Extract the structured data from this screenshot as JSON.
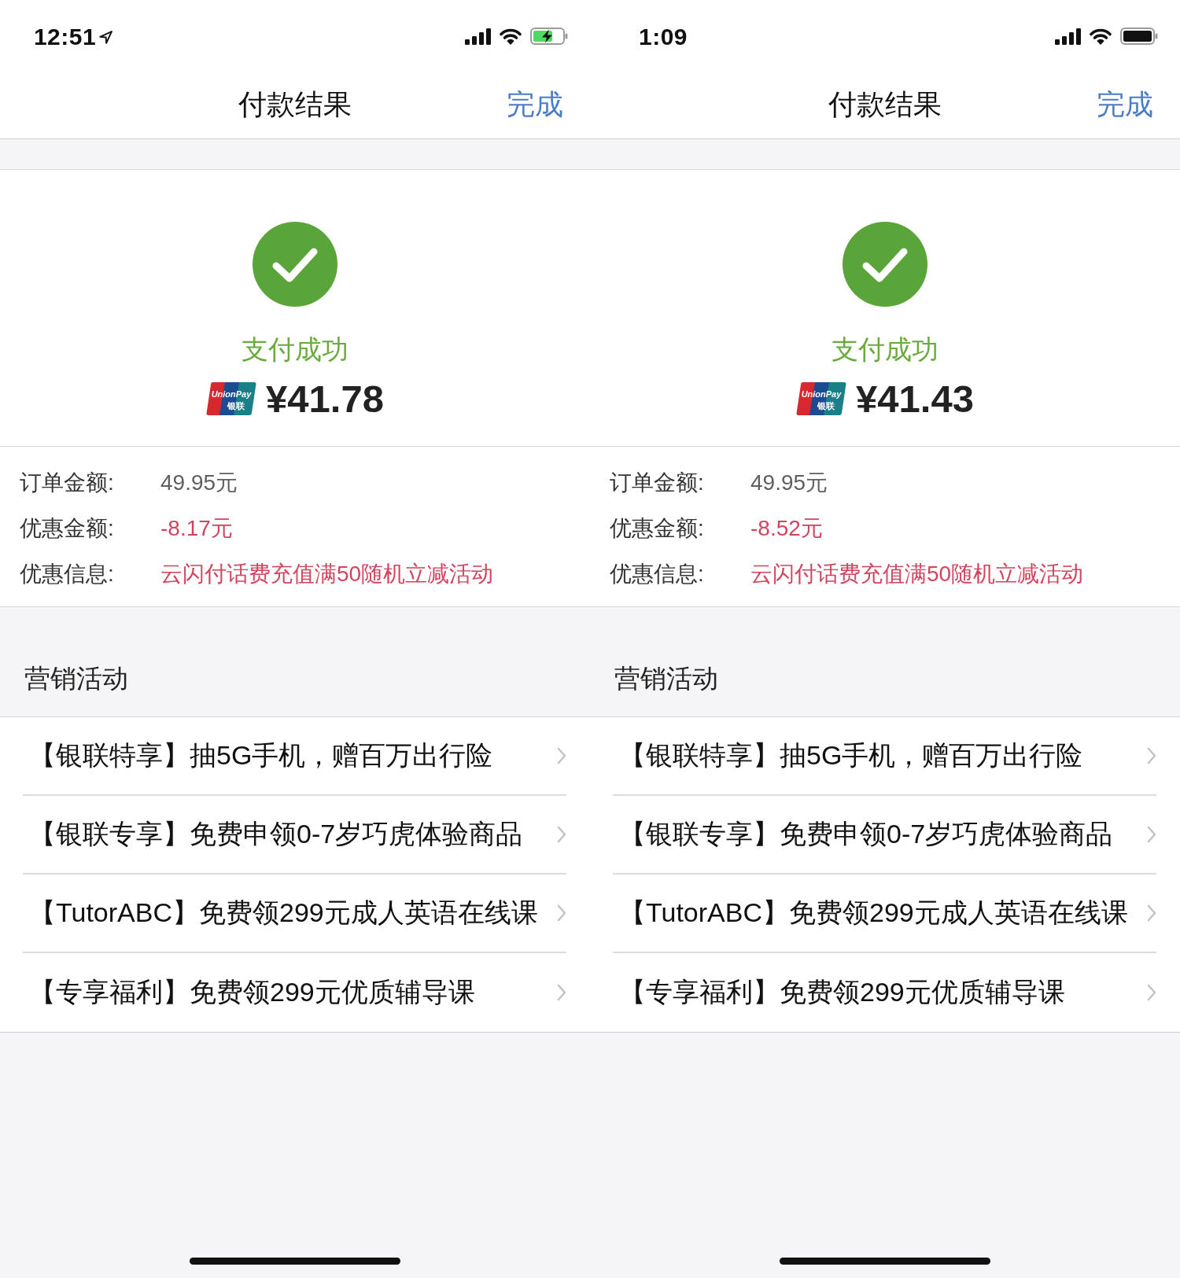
{
  "screens": [
    {
      "status_bar": {
        "time": "12:51",
        "location_services": true,
        "charging": true
      },
      "nav_bar": {
        "title": "付款结果",
        "done_button": "完成"
      },
      "result": {
        "status": "支付成功",
        "card_logo": {
          "latin": "UnionPay",
          "chinese": "银联"
        },
        "amount": "¥41.78"
      },
      "details": [
        {
          "label": "订单金额:",
          "value": "49.95元",
          "kind": "amount"
        },
        {
          "label": "优惠金额:",
          "value": "-8.17元",
          "kind": "discount"
        },
        {
          "label": "优惠信息:",
          "value": "云闪付话费充值满50随机立减活动",
          "kind": "discount"
        }
      ],
      "promotions": {
        "title": "营销活动",
        "items": [
          "【银联特享】抽5G手机，赠百万出行险",
          "【银联专享】免费申领0-7岁巧虎体验商品",
          "【TutorABC】免费领299元成人英语在线课",
          "【专享福利】免费领299元优质辅导课"
        ]
      }
    },
    {
      "status_bar": {
        "time": "1:09",
        "location_services": false,
        "charging": false
      },
      "nav_bar": {
        "title": "付款结果",
        "done_button": "完成"
      },
      "result": {
        "status": "支付成功",
        "card_logo": {
          "latin": "UnionPay",
          "chinese": "银联"
        },
        "amount": "¥41.43"
      },
      "details": [
        {
          "label": "订单金额:",
          "value": "49.95元",
          "kind": "amount"
        },
        {
          "label": "优惠金额:",
          "value": "-8.52元",
          "kind": "discount"
        },
        {
          "label": "优惠信息:",
          "value": "云闪付话费充值满50随机立减活动",
          "kind": "discount"
        }
      ],
      "promotions": {
        "title": "营销活动",
        "items": [
          "【银联特享】抽5G手机，赠百万出行险",
          "【银联专享】免费申领0-7岁巧虎体验商品",
          "【TutorABC】免费领299元成人英语在线课",
          "【专享福利】免费领299元优质辅导课"
        ]
      }
    }
  ]
}
